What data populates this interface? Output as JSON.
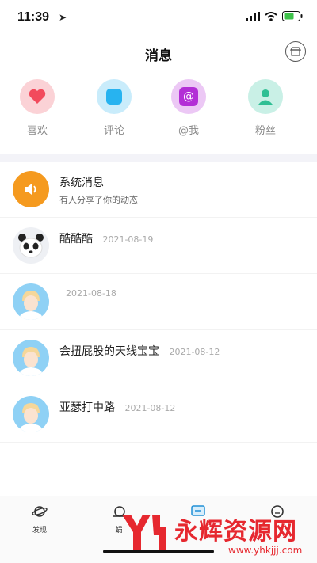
{
  "status": {
    "time": "11:39"
  },
  "header": {
    "title": "消息",
    "action_icon": "shop-icon"
  },
  "quick_actions": [
    {
      "label": "喜欢",
      "icon": "heart-icon",
      "color": "#fbd2d6",
      "fg": "#f24a5c"
    },
    {
      "label": "评论",
      "icon": "comment-icon",
      "color": "#c9ecfb",
      "fg": "#27b3f0"
    },
    {
      "label": "@我",
      "icon": "at-icon",
      "color": "#ecc8f5",
      "fg": "#b32fd6"
    },
    {
      "label": "粉丝",
      "icon": "fans-icon",
      "color": "#c9f0e6",
      "fg": "#2fbf94"
    }
  ],
  "messages": [
    {
      "title": "系统消息",
      "date": "",
      "subtitle": "有人分享了你的动态",
      "avatar": "speaker"
    },
    {
      "title": "酷酷酷",
      "date": "2021-08-19",
      "subtitle": "",
      "avatar": "panda"
    },
    {
      "title": "",
      "date": "2021-08-18",
      "subtitle": "",
      "avatar": "person"
    },
    {
      "title": "会扭屁股的天线宝宝",
      "date": "2021-08-12",
      "subtitle": "",
      "avatar": "person"
    },
    {
      "title": "亚瑟打中路",
      "date": "2021-08-12",
      "subtitle": "",
      "avatar": "person"
    }
  ],
  "tabs": [
    {
      "label": "发现",
      "icon": "planet-icon"
    },
    {
      "label": "蜗",
      "icon": "snail-icon"
    },
    {
      "label": "",
      "icon": "message-icon"
    },
    {
      "label": "",
      "icon": "profile-icon"
    }
  ],
  "watermark": {
    "text": "永辉资源网",
    "url": "www.yhkjjj.com"
  },
  "colors": {
    "system_avatar": "#f59a1f",
    "person_avatar_bg": "#8fd1f5",
    "accent": "#e6282f"
  }
}
